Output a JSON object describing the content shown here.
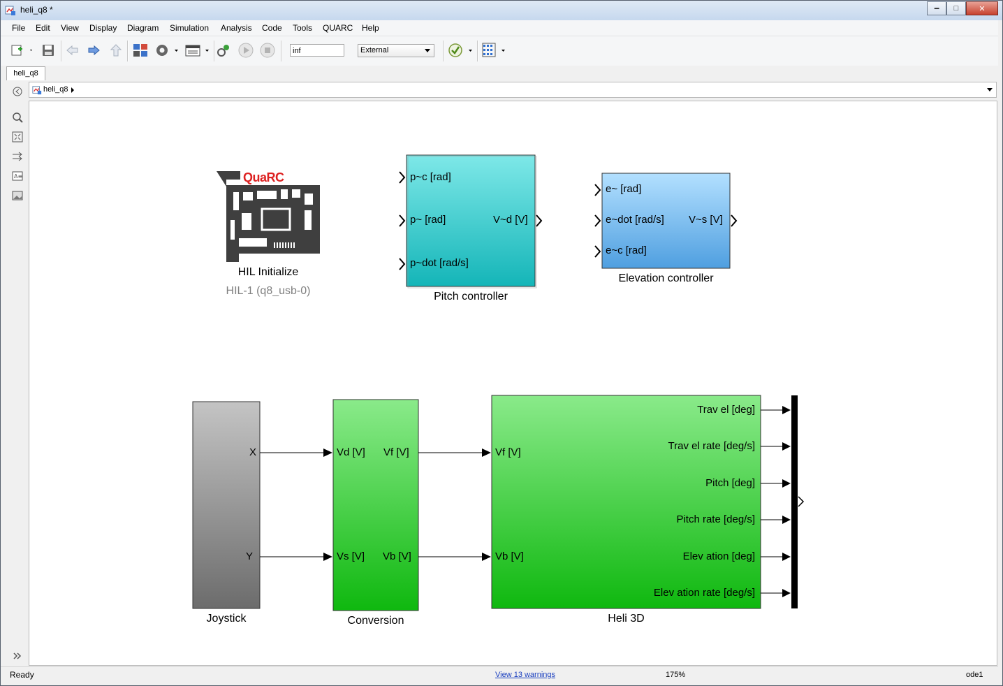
{
  "window": {
    "title": "heli_q8 *"
  },
  "menu": [
    "File",
    "Edit",
    "View",
    "Display",
    "Diagram",
    "Simulation",
    "Analysis",
    "Code",
    "Tools",
    "QUARC",
    "Help"
  ],
  "toolbar": {
    "stop_time": "inf",
    "sim_mode": "External"
  },
  "tab": {
    "label": "heli_q8"
  },
  "breadcrumb": {
    "model": "heli_q8"
  },
  "blocks": {
    "hil": {
      "logo_text": "QuaRC",
      "name": "HIL Initialize",
      "sub": "HIL-1 (q8_usb-0)"
    },
    "pitch": {
      "name": "Pitch controller",
      "in": [
        "p~c [rad]",
        "p~ [rad]",
        "p~dot [rad/s]"
      ],
      "out": "V~d [V]"
    },
    "elevation": {
      "name": "Elevation controller",
      "in": [
        "e~ [rad]",
        "e~dot [rad/s]",
        "e~c [rad]"
      ],
      "out": "V~s [V]"
    },
    "joystick": {
      "name": "Joystick",
      "out": [
        "X",
        "Y"
      ]
    },
    "conversion": {
      "name": "Conversion",
      "in": [
        "Vd [V]",
        "Vs [V]"
      ],
      "out": [
        "Vf  [V]",
        "Vb [V]"
      ]
    },
    "heli": {
      "name": "Heli 3D",
      "in": [
        "Vf  [V]",
        "Vb [V]"
      ],
      "out": [
        "Trav el [deg]",
        "Trav el rate [deg/s]",
        "Pitch [deg]",
        "Pitch rate [deg/s]",
        "Elev ation [deg]",
        "Elev ation rate [deg/s]"
      ]
    }
  },
  "status": {
    "left": "Ready",
    "warnings": "View 13 warnings",
    "zoom": "175%",
    "solver": "ode1"
  },
  "colors": {
    "pitch_top": "#7ee8e8",
    "pitch_bottom": "#14b5b8",
    "elev_top": "#b3e0ff",
    "elev_bottom": "#4f9fe0",
    "green_top": "#8aea8a",
    "green_bottom": "#0fb80f",
    "joy_top": "#c4c4c4",
    "joy_bottom": "#6c6c6c"
  }
}
